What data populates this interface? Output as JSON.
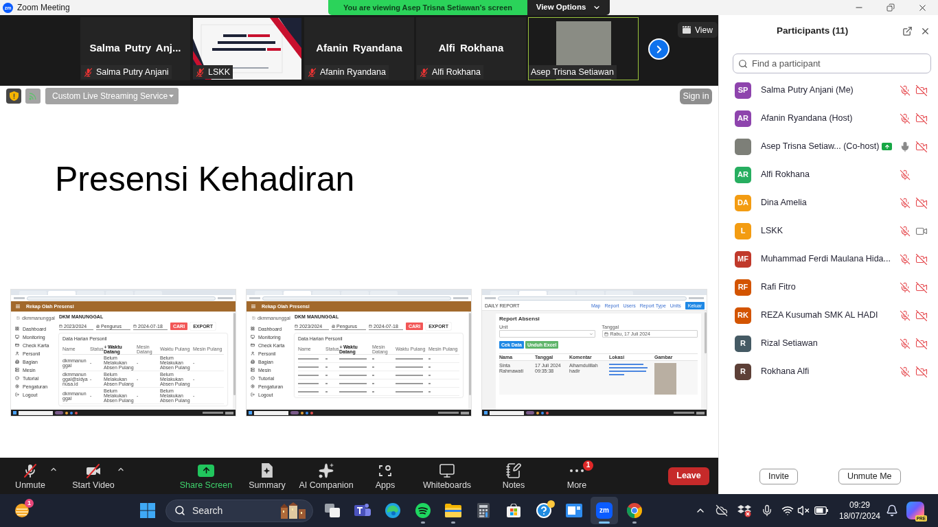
{
  "window": {
    "logo": "zm",
    "title": "Zoom Meeting",
    "banner": "You are viewing Asep Trisna Setiawan's screen",
    "view_options": "View Options"
  },
  "video_strip": {
    "tiles": [
      {
        "kind": "name",
        "display_name": "Salma Putry Anj...",
        "nameplate": "Salma Putry Anjani",
        "muted": true,
        "active": false
      },
      {
        "kind": "slide",
        "nameplate": "LSKK",
        "muted": true,
        "active": false
      },
      {
        "kind": "name",
        "display_name": "Afanin Ryandana",
        "nameplate": "Afanin Ryandana",
        "muted": true,
        "active": false
      },
      {
        "kind": "name",
        "display_name": "Alfi Rokhana",
        "nameplate": "Alfi Rokhana",
        "muted": true,
        "active": false
      },
      {
        "kind": "photo",
        "nameplate": "Asep Trisna Setiawan",
        "muted": false,
        "active": true
      }
    ],
    "view_button": "View"
  },
  "share_controls": {
    "stream_service": "Custom Live Streaming Service",
    "sign_in": "Sign in"
  },
  "slide": {
    "title": "Presensi Kehadiran",
    "screenshots": [
      {
        "kind": "presensi",
        "header": "Rekap Olah Presensi",
        "account": "dkmmanunggal",
        "org": "DKM MANUNGGAL",
        "menu": [
          "Dashboard",
          "Monitoring",
          "Check Karta",
          "Personil",
          "Bagian",
          "Mesin",
          "Tutorial",
          "Pengaturan",
          "Logout"
        ],
        "filters": [
          "2023/2024",
          "Pengurus",
          "2024-07-18"
        ],
        "search_button": "CARI",
        "export_button": "EXPORT",
        "card_title": "Data Harian Personil",
        "columns": [
          {
            "label": "Name",
            "sorted": false
          },
          {
            "label": "Status",
            "sorted": false
          },
          {
            "label": "Waktu Datang",
            "sorted": true
          },
          {
            "label": "Mesin Datang",
            "sorted": false
          },
          {
            "label": "Waktu Pulang",
            "sorted": false
          },
          {
            "label": "Mesin Pulang",
            "sorted": false
          }
        ],
        "rows": [
          [
            "dkmmanunggal",
            "-",
            "Belum Melakukan Absen Pulang",
            "-",
            "Belum Melakukan Absen Pulang",
            "-"
          ],
          [
            "dkmmanunggal@sidyanusa.id",
            "-",
            "Belum Melakukan Absen Pulang",
            "-",
            "Belum Melakukan Absen Pulang",
            "-"
          ],
          [
            "dkmmanunggal",
            "-",
            "Belum Melakukan Absen Pulang",
            "-",
            "Belum Melakukan Absen Pulang",
            "-"
          ]
        ]
      },
      {
        "kind": "presensi",
        "header": "Rekap Olah Presensi",
        "account": "dkmmanunggal",
        "org": "DKM MANUNGGAL",
        "menu": [
          "Dashboard",
          "Monitoring",
          "Check Karta",
          "Personil",
          "Bagian",
          "Mesin",
          "Tutorial",
          "Pengaturan",
          "Logout"
        ],
        "filters": [
          "2023/2024",
          "Pengurus",
          "2024-07-18"
        ],
        "search_button": "CARI",
        "export_button": "EXPORT",
        "card_title": "Data Harian Personil",
        "columns": [
          {
            "label": "Name",
            "sorted": false
          },
          {
            "label": "Status",
            "sorted": false
          },
          {
            "label": "Waktu Datang",
            "sorted": true
          },
          {
            "label": "Mesin Datang",
            "sorted": false
          },
          {
            "label": "Waktu Pulang",
            "sorted": false
          },
          {
            "label": "Mesin Pulang",
            "sorted": false
          }
        ]
      },
      {
        "kind": "report",
        "brand": "DAILY REPORT",
        "nav": [
          "Map",
          "Report",
          "Users",
          "Report Type",
          "Units"
        ],
        "nav_button": "Keluar",
        "card_title": "Report Absensi",
        "fields": [
          {
            "label": "Unit"
          },
          {
            "label": "Tanggal",
            "value": "Rabu, 17 Juli 2024"
          }
        ],
        "buttons": [
          {
            "label": "Cek Data",
            "kind": "primary"
          },
          {
            "label": "Unduh Excel",
            "kind": "success"
          }
        ],
        "columns": [
          "Nama",
          "Tanggal",
          "Komentar",
          "Lokasi",
          "Gambar"
        ],
        "row": [
          "Sinta Rahmawati",
          "17 Juli 2024 09:35:38",
          "Alhamdulillah hadir"
        ]
      }
    ]
  },
  "toolbar": {
    "items": [
      {
        "kind": "mic",
        "label": "Unmute",
        "menu": true,
        "highlight": false
      },
      {
        "kind": "video",
        "label": "Start Video",
        "menu": true,
        "highlight": false
      },
      {
        "kind": "share",
        "label": "Share Screen",
        "menu": false,
        "highlight": true
      },
      {
        "kind": "summary",
        "label": "Summary",
        "menu": false,
        "highlight": false
      },
      {
        "kind": "ai",
        "label": "AI Companion",
        "menu": false,
        "highlight": false
      },
      {
        "kind": "apps",
        "label": "Apps",
        "menu": false,
        "highlight": false
      },
      {
        "kind": "whiteboard",
        "label": "Whiteboards",
        "menu": false,
        "highlight": false
      },
      {
        "kind": "notes",
        "label": "Notes",
        "menu": false,
        "highlight": false
      },
      {
        "kind": "more",
        "label": "More",
        "menu": false,
        "highlight": false,
        "badge": "1"
      }
    ],
    "leave": "Leave"
  },
  "participants": {
    "title": "Participants (11)",
    "search": {
      "placeholder": "Find a participant"
    },
    "items": [
      {
        "kind": "initials",
        "initials": "SP",
        "color": "#8e44ad",
        "name": "Salma Putry Anjani (Me)",
        "sharing": false,
        "mic_muted": true,
        "video_off": true
      },
      {
        "kind": "initials",
        "initials": "AR",
        "color": "#8e44ad",
        "name": "Afanin Ryandana (Host)",
        "sharing": false,
        "mic_muted": true,
        "video_off": true
      },
      {
        "kind": "photo",
        "name": "Asep Trisna Setiaw... (Co-host)",
        "sharing": true,
        "mic_muted": false,
        "video_off": true
      },
      {
        "kind": "initials",
        "initials": "AR",
        "color": "#27ae60",
        "name": "Alfi Rokhana",
        "sharing": false,
        "mic_muted": true
      },
      {
        "kind": "initials",
        "initials": "DA",
        "color": "#f39c12",
        "name": "Dina Amelia",
        "sharing": false,
        "mic_muted": true,
        "video_off": true
      },
      {
        "kind": "initials",
        "initials": "L",
        "color": "#f39c12",
        "name": "LSKK",
        "sharing": false,
        "mic_muted": true,
        "video_off": false
      },
      {
        "kind": "initials",
        "initials": "MF",
        "color": "#c0392b",
        "name": "Muhammad Ferdi Maulana Hida...",
        "sharing": false,
        "mic_muted": true,
        "video_off": true
      },
      {
        "kind": "initials",
        "initials": "RF",
        "color": "#d35400",
        "name": "Rafi Fitro",
        "sharing": false,
        "mic_muted": true,
        "video_off": true
      },
      {
        "kind": "initials",
        "initials": "RK",
        "color": "#d35400",
        "name": "REZA Kusumah SMK AL HADI",
        "sharing": false,
        "mic_muted": true,
        "video_off": true
      },
      {
        "kind": "initials",
        "initials": "R",
        "color": "#455a64",
        "name": "Rizal Setiawan",
        "sharing": false,
        "mic_muted": true,
        "video_off": true
      },
      {
        "kind": "initials",
        "initials": "R",
        "color": "#5d4037",
        "name": "Rokhana Alfi",
        "sharing": false,
        "mic_muted": true,
        "video_off": true
      }
    ],
    "buttons": [
      "Invite",
      "Unmute Me"
    ]
  },
  "taskbar": {
    "weather_badge": "1",
    "search": "Search",
    "apps": [
      {
        "kind": "task-view",
        "running": false,
        "active": false
      },
      {
        "kind": "teams",
        "running": false,
        "active": false
      },
      {
        "kind": "edge",
        "running": false,
        "active": false
      },
      {
        "kind": "spotify",
        "running": true,
        "active": false
      },
      {
        "kind": "explorer",
        "running": true,
        "active": false
      },
      {
        "kind": "calculator",
        "running": false,
        "active": false
      },
      {
        "kind": "store",
        "running": false,
        "active": false
      },
      {
        "kind": "help",
        "running": false,
        "active": false
      },
      {
        "kind": "viewer",
        "running": false,
        "active": false
      },
      {
        "kind": "zoom",
        "logo": "zm",
        "running": true,
        "active": true
      },
      {
        "kind": "chrome",
        "running": true,
        "active": false
      }
    ],
    "time": "09:29",
    "date": "18/07/2024",
    "copilot_badge": "PRE"
  }
}
